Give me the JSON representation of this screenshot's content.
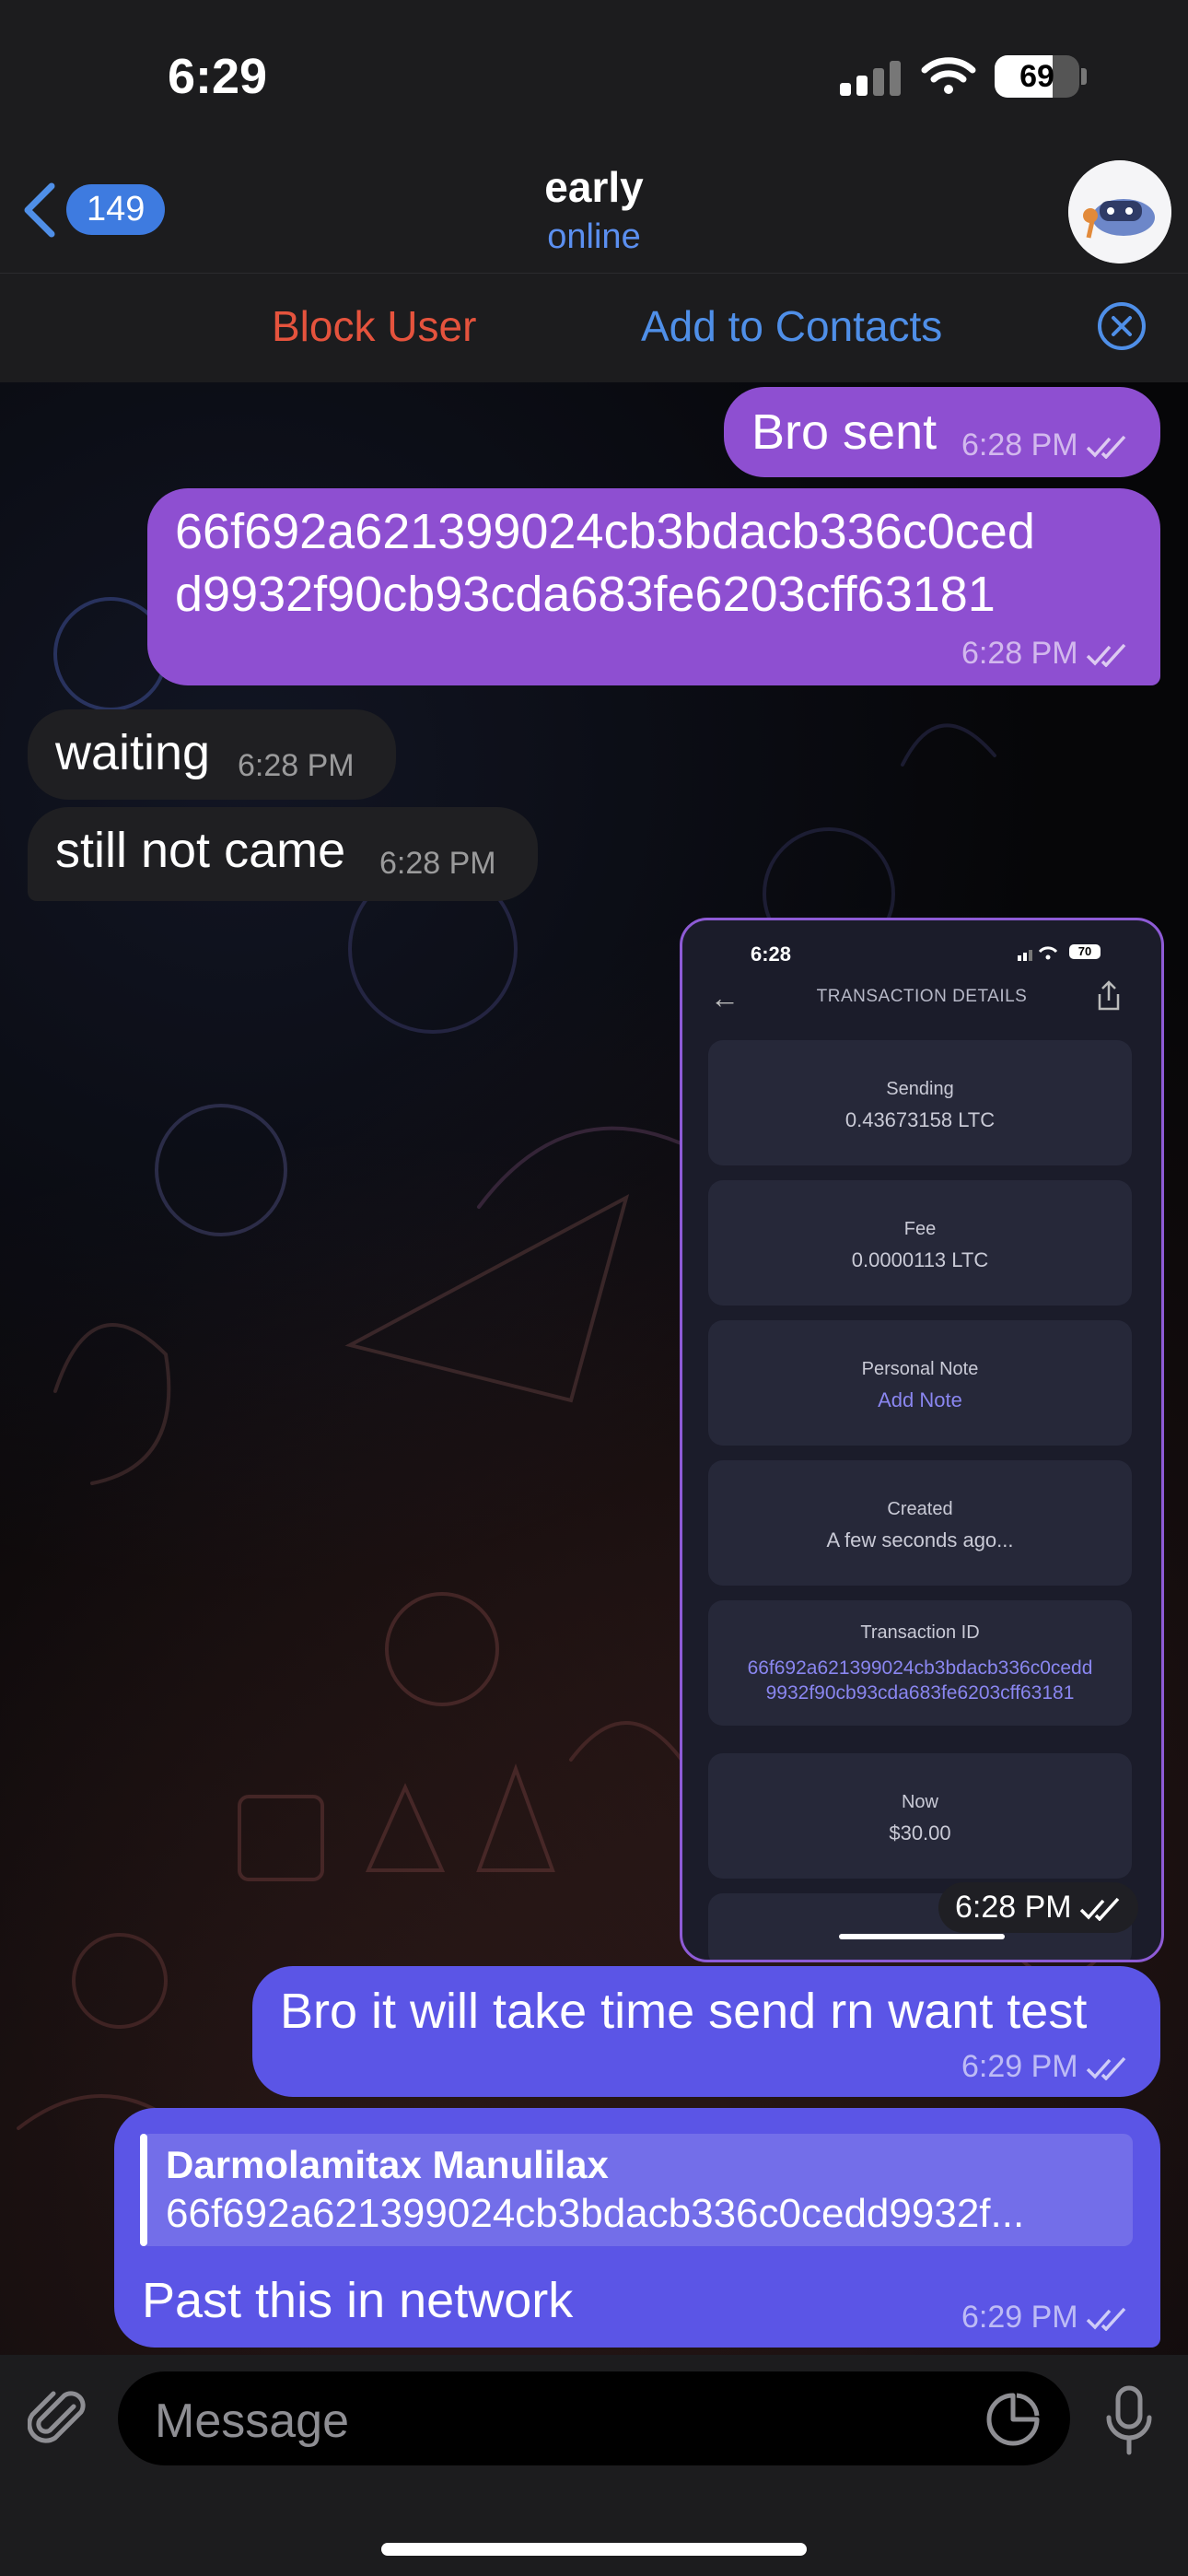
{
  "status": {
    "time": "6:29",
    "battery": "69"
  },
  "header": {
    "back_count": "149",
    "title": "early",
    "subtitle": "online"
  },
  "action_bar": {
    "block": "Block User",
    "add_contact": "Add to Contacts"
  },
  "messages": [
    {
      "text": "Bro sent",
      "time": "6:28 PM"
    },
    {
      "line1": "66f692a621399024cb3bdacb336c0ced",
      "line2": "d9932f90cb93cda683fe6203cff63181",
      "time": "6:28 PM"
    },
    {
      "text": "waiting",
      "time": "6:28 PM"
    },
    {
      "text": "still not came",
      "time": "6:28 PM"
    },
    {
      "time": "6:28 PM"
    },
    {
      "text": "Bro it will take time send rn want test",
      "time": "6:29 PM"
    },
    {
      "reply_name": "Darmolamitax Manulilax",
      "reply_text": "66f692a621399024cb3bdacb336c0cedd9932f...",
      "text": "Past this in network",
      "time": "6:29 PM"
    }
  ],
  "screenshot": {
    "time": "6:28",
    "battery": "70",
    "header": "TRANSACTION DETAILS",
    "fields": [
      {
        "label": "Sending",
        "value": "0.43673158 LTC"
      },
      {
        "label": "Fee",
        "value": "0.0000113 LTC"
      },
      {
        "label": "Personal Note",
        "value": "Add Note"
      },
      {
        "label": "Created",
        "value": "A few seconds ago..."
      },
      {
        "label": "Transaction ID",
        "value1": "66f692a621399024cb3bdacb336c0cedd",
        "value2": "9932f90cb93cda683fe6203cff63181"
      },
      {
        "label": "Now",
        "value": "$30.00"
      }
    ]
  },
  "input": {
    "placeholder": "Message"
  },
  "colors": {
    "outgoing_purple": "#8e4fd1",
    "outgoing_indigo": "#5b55e6",
    "incoming": "#1f1f22",
    "link": "#4f8fe8",
    "danger": "#e5533d"
  }
}
